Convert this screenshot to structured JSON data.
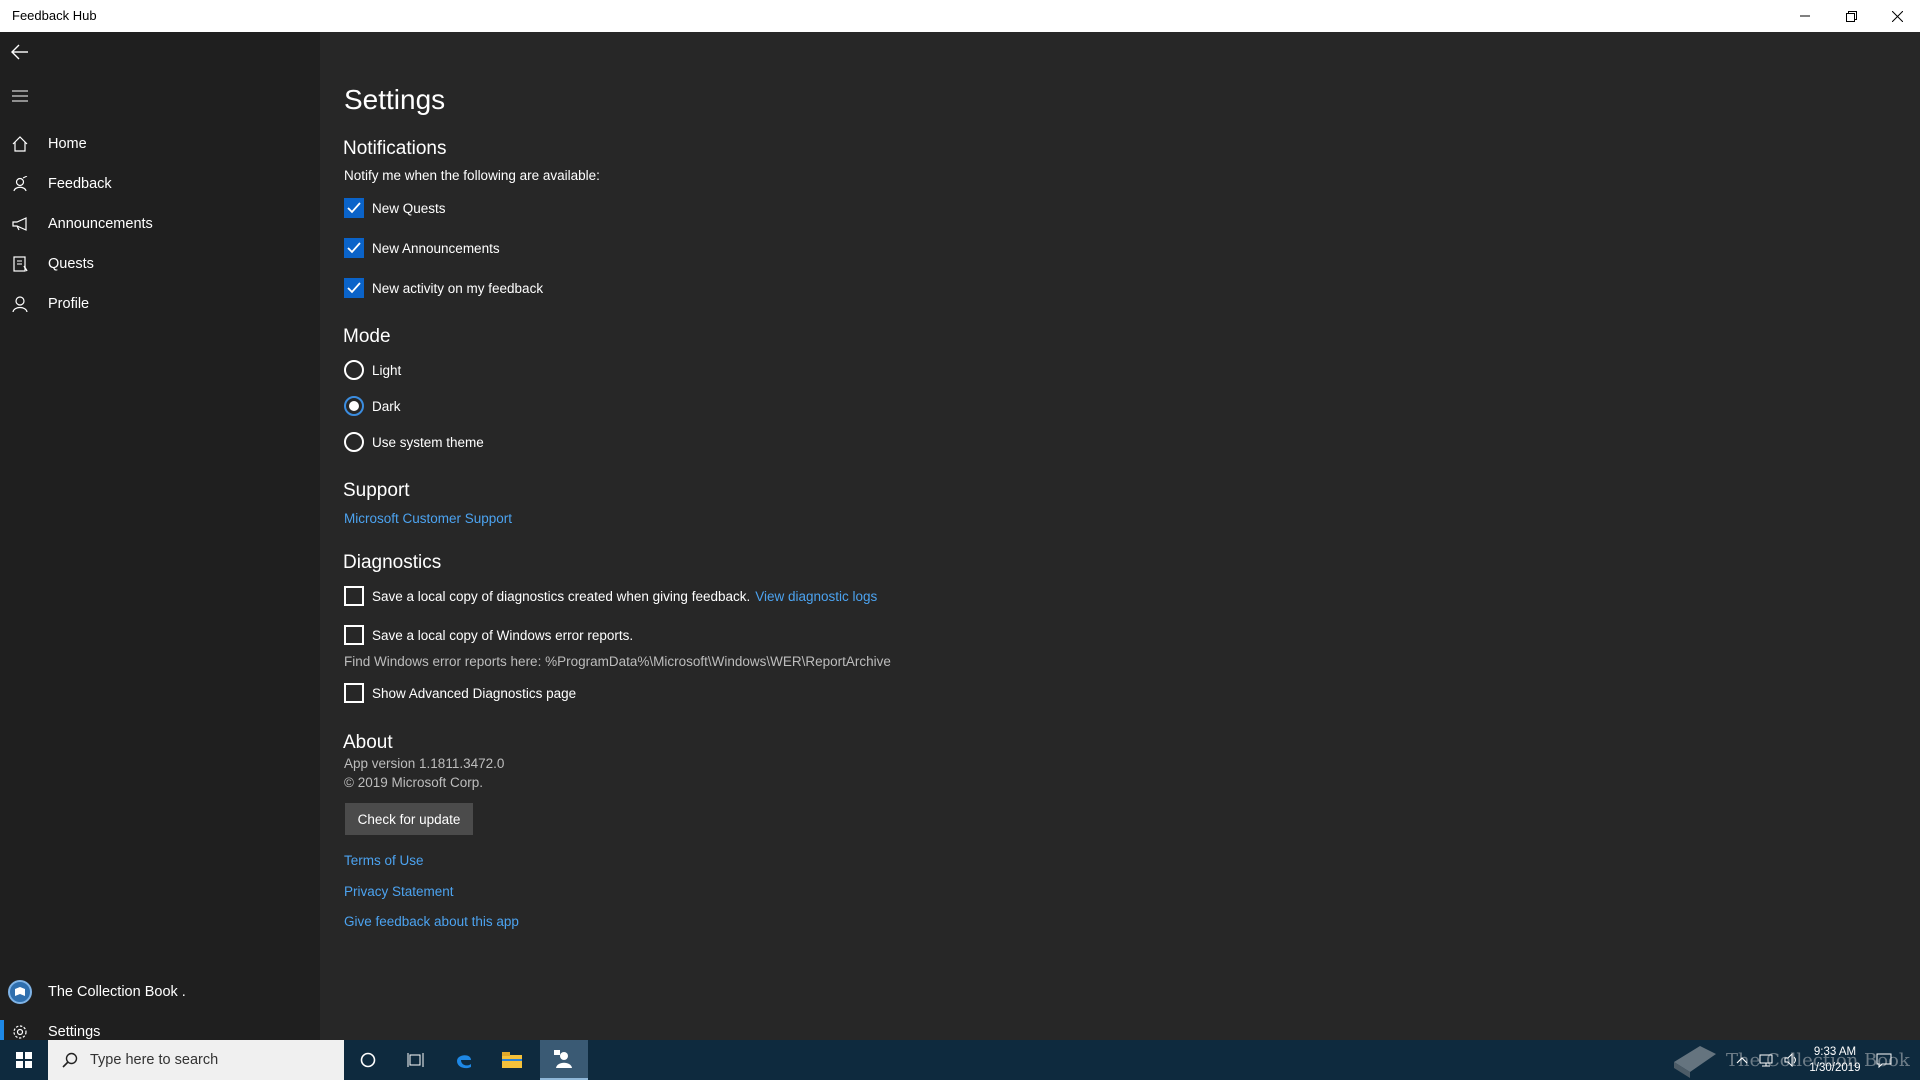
{
  "window": {
    "title": "Feedback Hub"
  },
  "sidebar": {
    "items": [
      {
        "label": "Home",
        "icon": "home-icon"
      },
      {
        "label": "Feedback",
        "icon": "feedback-icon"
      },
      {
        "label": "Announcements",
        "icon": "megaphone-icon"
      },
      {
        "label": "Quests",
        "icon": "quests-icon"
      },
      {
        "label": "Profile",
        "icon": "person-icon"
      }
    ],
    "account_label": "The Collection Book .",
    "settings_label": "Settings"
  },
  "main": {
    "page_title": "Settings",
    "notifications": {
      "title": "Notifications",
      "description": "Notify me when the following are available:",
      "options": [
        {
          "label": "New Quests",
          "checked": true
        },
        {
          "label": "New Announcements",
          "checked": true
        },
        {
          "label": "New activity on my feedback",
          "checked": true
        }
      ]
    },
    "mode": {
      "title": "Mode",
      "options": [
        {
          "label": "Light",
          "selected": false
        },
        {
          "label": "Dark",
          "selected": true
        },
        {
          "label": "Use system theme",
          "selected": false
        }
      ]
    },
    "support": {
      "title": "Support",
      "link": "Microsoft Customer Support"
    },
    "diagnostics": {
      "title": "Diagnostics",
      "save_diag_label": "Save a local copy of diagnostics created when giving feedback.",
      "view_logs_link": "View diagnostic logs",
      "save_wer_label": "Save a local copy of Windows error reports.",
      "wer_path_text": "Find Windows error reports here: %ProgramData%\\Microsoft\\Windows\\WER\\ReportArchive",
      "advanced_label": "Show Advanced Diagnostics page"
    },
    "about": {
      "title": "About",
      "version": "App version 1.1811.3472.0",
      "copyright": "© 2019 Microsoft Corp.",
      "update_button": "Check for update",
      "links": [
        "Terms of Use",
        "Privacy Statement",
        "Give feedback about this app"
      ]
    }
  },
  "taskbar": {
    "search_placeholder": "Type here to search",
    "time": "9:33 AM",
    "date": "1/30/2019",
    "watermark": "The Collection Book"
  },
  "colors": {
    "accent": "#0a63c9",
    "link": "#4ca3f0",
    "background": "#272727",
    "sidebar": "#1f1f1f"
  }
}
